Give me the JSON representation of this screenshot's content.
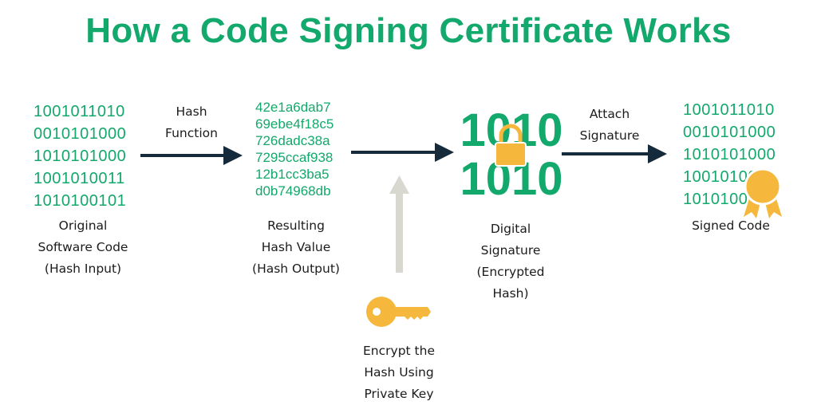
{
  "title": "How a Code Signing Certificate Works",
  "colors": {
    "brand_green": "#13a86c",
    "arrow_dark": "#152a3a",
    "arrow_light": "#d8d8d0",
    "gold": "#f5b83d"
  },
  "original_code": {
    "lines": [
      "1001011010",
      "0010101000",
      "1010101000",
      "1001010011",
      "1010100101"
    ],
    "label": [
      "Original",
      "Software Code",
      "(Hash Input)"
    ]
  },
  "hash_function": {
    "label": [
      "Hash",
      "Function"
    ]
  },
  "hash_value": {
    "lines": [
      "42e1a6dab7",
      "69ebe4f18c5",
      "726dadc38a",
      "7295ccaf938",
      "12b1cc3ba5",
      "d0b74968db"
    ],
    "label": [
      "Resulting",
      "Hash Value",
      "(Hash Output)"
    ]
  },
  "private_key": {
    "icon": "key-icon",
    "label": [
      "Encrypt the",
      "Hash Using",
      "Private Key"
    ]
  },
  "digital_signature": {
    "icon": "locked-binary-icon",
    "glyph_rows": [
      "1010",
      "1010"
    ],
    "label": [
      "Digital",
      "Signature",
      "(Encrypted",
      "Hash)"
    ]
  },
  "attach_signature": {
    "label": [
      "Attach",
      "Signature"
    ]
  },
  "signed_code": {
    "lines": [
      "1001011010",
      "0010101000",
      "1010101000",
      "1001010011",
      "1010100101"
    ],
    "icon": "award-ribbon-icon",
    "label": [
      "Signed Code"
    ]
  }
}
